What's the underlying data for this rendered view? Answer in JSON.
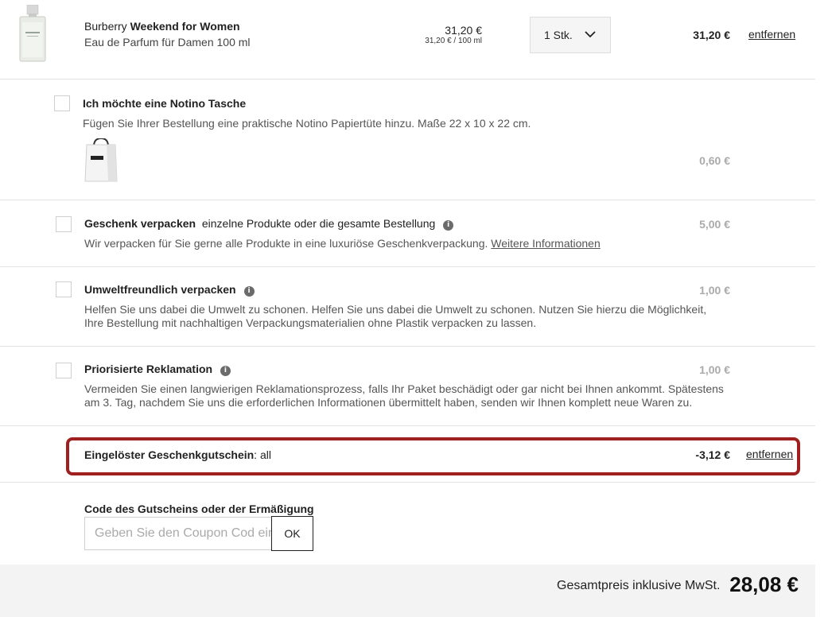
{
  "product": {
    "brand": "Burberry",
    "name": "Weekend for Women",
    "subtitle": "Eau de Parfum für Damen 100 ml",
    "unit_price": "31,20 €",
    "unit_per": "31,20 € / 100 ml",
    "quantity": "1 Stk.",
    "total": "31,20 €",
    "remove_label": "entfernen"
  },
  "options": {
    "bag": {
      "title": "Ich möchte eine Notino Tasche",
      "description": "Fügen Sie Ihrer Bestellung eine praktische Notino Papiertüte hinzu. Maße 22 x 10 x 22 cm.",
      "price": "0,60 €",
      "checked": false
    },
    "gift_wrap": {
      "title": "Geschenk verpacken",
      "title_extra": "einzelne Produkte oder die gesamte Bestellung",
      "description": "Wir verpacken für Sie gerne alle Produkte in eine luxuriöse Geschenkverpackung.",
      "link": "Weitere Informationen",
      "price": "5,00 €",
      "checked": false
    },
    "eco": {
      "title": "Umweltfreundlich verpacken",
      "description": "Helfen Sie uns dabei die Umwelt zu schonen. Helfen Sie uns dabei die Umwelt zu schonen. Nutzen Sie hierzu die Möglichkeit, Ihre Bestellung mit nachhaltigen Verpackungsmaterialien ohne Plastik verpacken zu lassen.",
      "price": "1,00 €",
      "checked": false
    },
    "claim": {
      "title": "Priorisierte Reklamation",
      "description": "Vermeiden Sie einen langwierigen Reklamationsprozess, falls Ihr Paket beschädigt oder gar nicht bei Ihnen ankommt. Spätestens am 3. Tag, nachdem Sie uns die erforderlichen Informationen übermittelt haben, senden wir Ihnen komplett neue Waren zu.",
      "price": "1,00 €",
      "checked": false
    }
  },
  "voucher": {
    "label": "Eingelöster Geschenkgutschein",
    "value": ": all",
    "amount": "-3,12 €",
    "remove_label": "entfernen"
  },
  "coupon": {
    "label": "Code des Gutscheins oder der Ermäßigung",
    "placeholder": "Geben Sie den Coupon Cod ein",
    "button": "OK"
  },
  "total": {
    "label": "Gesamtpreis inklusive MwSt.",
    "amount": "28,08 €"
  },
  "icons": {
    "info": "info-icon",
    "chevron": "chevron-down-icon"
  },
  "colors": {
    "highlight_border": "#a02020",
    "muted_price": "#aaaaaa",
    "total_bar_bg": "#f3f3f3"
  }
}
